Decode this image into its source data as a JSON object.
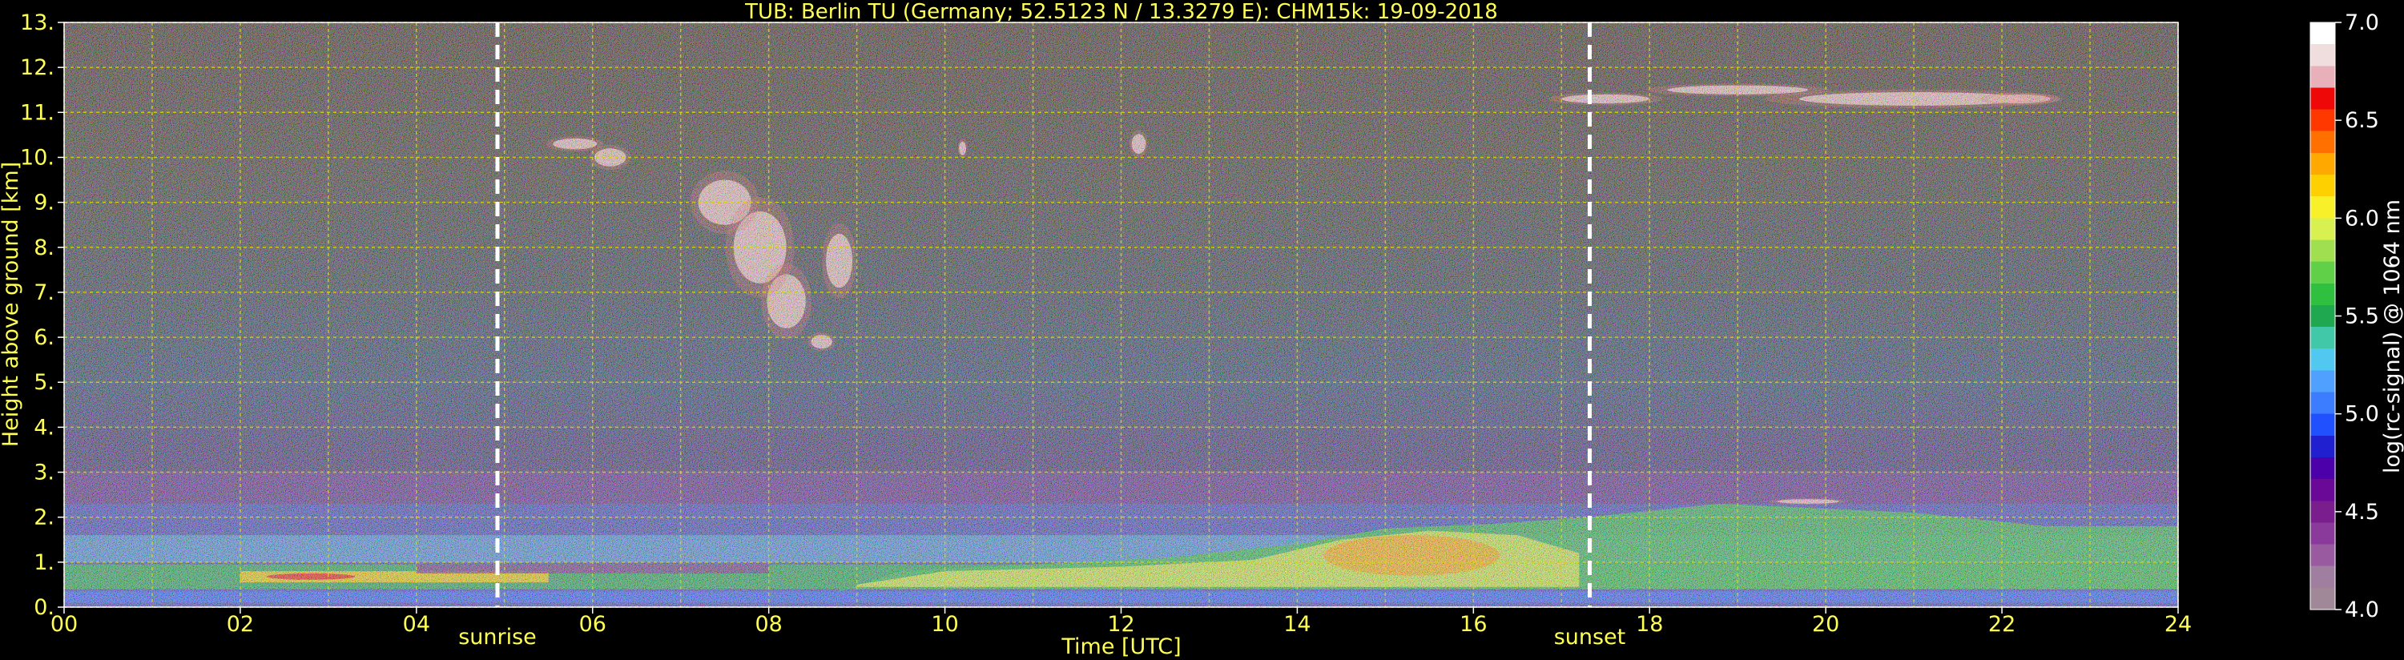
{
  "chart_data": {
    "type": "heatmap",
    "title": "TUB: Berlin TU (Germany; 52.5123 N / 13.3279 E):    CHM15k: 19-09-2018",
    "xlabel": "Time [UTC]",
    "ylabel": "Height above ground [km]",
    "xlim": [
      0,
      24
    ],
    "ylim": [
      0,
      13
    ],
    "x_tick_labels": [
      "00",
      "02",
      "04",
      "06",
      "08",
      "10",
      "12",
      "14",
      "16",
      "18",
      "20",
      "22",
      "24"
    ],
    "y_tick_labels": [
      "0.",
      "1.",
      "2.",
      "3.",
      "4.",
      "5.",
      "6.",
      "7.",
      "8.",
      "9.",
      "10.",
      "11.",
      "12.",
      "13."
    ],
    "grid": true,
    "colorbar": {
      "label": "log(rc-signal) @ 1064 nm",
      "range": [
        4.0,
        7.0
      ],
      "tick_labels": [
        "4.0",
        "4.5",
        "5.0",
        "5.5",
        "6.0",
        "6.5",
        "7.0"
      ],
      "colors": [
        "#a08898",
        "#a07ea0",
        "#9a5aa0",
        "#8a3a9a",
        "#7a1e8e",
        "#6a0898",
        "#4c00aa",
        "#2020d0",
        "#2050ff",
        "#3c7cff",
        "#50a0ff",
        "#50c8f0",
        "#40c8a8",
        "#20a850",
        "#30c040",
        "#60d048",
        "#a0e050",
        "#d8f050",
        "#f8f028",
        "#ffd000",
        "#ffa800",
        "#ff7000",
        "#ff3800",
        "#ee0808",
        "#e8b0b8",
        "#f0dede",
        "#ffffff"
      ]
    },
    "markers": [
      {
        "label": "sunrise",
        "x": 4.92
      },
      {
        "label": "sunset",
        "x": 17.32
      }
    ]
  }
}
